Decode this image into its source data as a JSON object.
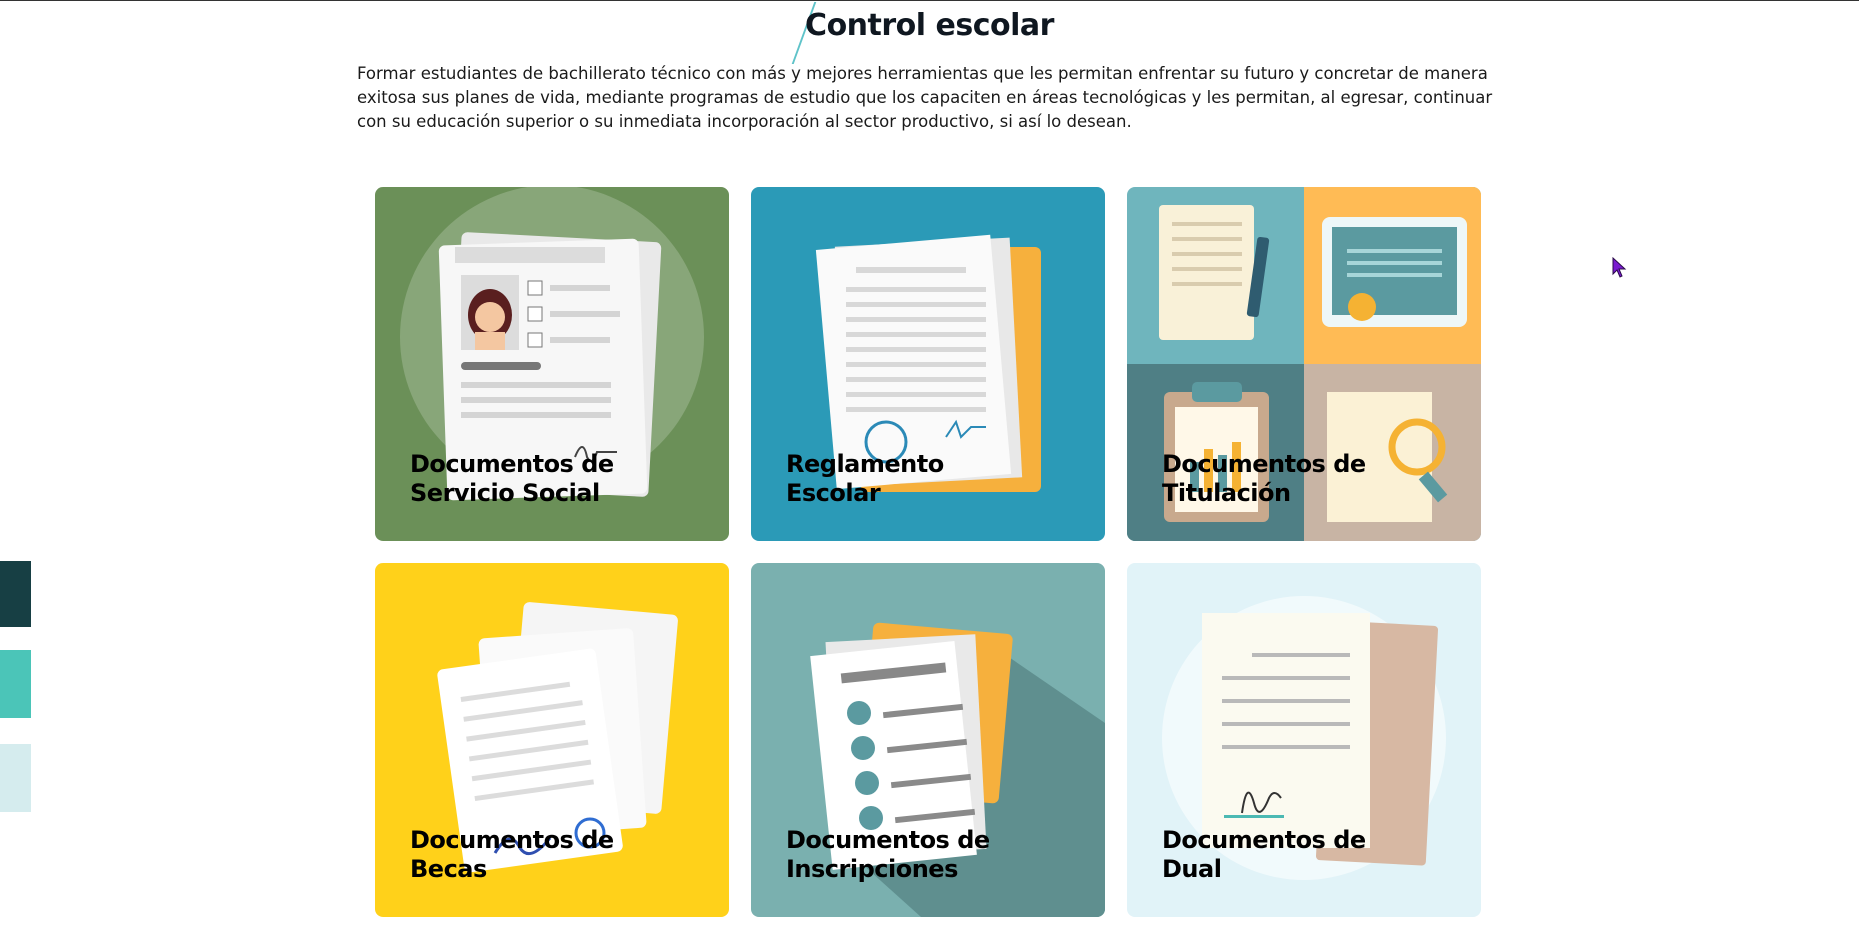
{
  "page": {
    "title": "Control escolar",
    "intro": "Formar estudiantes de bachillerato técnico con más y mejores herramientas que les permitan enfrentar su futuro y concretar de manera exitosa sus planes de vida, mediante programas de estudio que los capaciten en áreas tecnológicas y les permitan, al egresar, continuar con su educación superior o su inmediata incorporación al sector productivo, si así lo desean."
  },
  "cards": [
    {
      "line1": "Documentos de",
      "line2": "Servicio Social",
      "bg": "#6b9058"
    },
    {
      "line1": "Reglamento",
      "line2": "Escolar",
      "bg": "#2b9ab7"
    },
    {
      "line1": "Documentos de",
      "line2": "Titulación",
      "bg": "#6fb5bd"
    },
    {
      "line1": "Documentos de",
      "line2": "Becas",
      "bg": "#ffd11a"
    },
    {
      "line1": "Documentos de",
      "line2": "Inscripciones",
      "bg": "#7ab0af"
    },
    {
      "line1": "Documentos de",
      "line2": "Dual",
      "bg": "#e1f3f8"
    }
  ],
  "side_swatches": [
    "#173f44",
    "#4bc5b8",
    "#d5ecee"
  ],
  "icons": {
    "cursor": "mouse-pointer-icon",
    "card1": "resume-document-icon",
    "card2": "folder-document-icon",
    "card3": "diploma-certificate-icon",
    "card4": "paper-stack-icon",
    "card5": "checklist-folder-icon",
    "card6": "signed-letter-icon"
  }
}
